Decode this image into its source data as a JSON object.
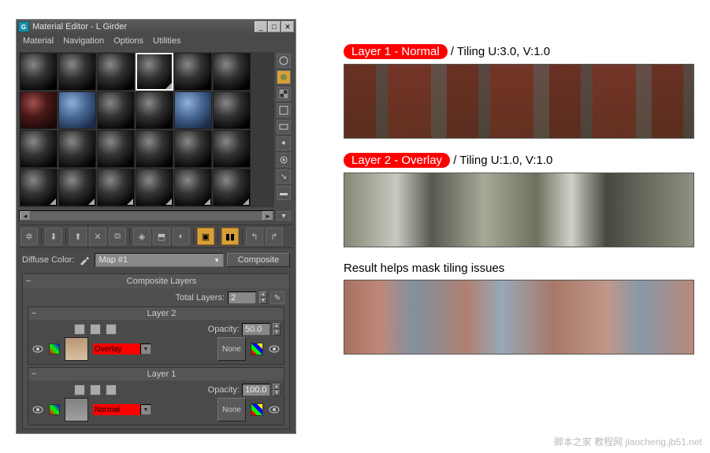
{
  "window": {
    "title": "Material Editor - L Girder",
    "app_icon_letter": "G"
  },
  "menubar": [
    "Material",
    "Navigation",
    "Options",
    "Utilities"
  ],
  "side_tools": {
    "sphere": "sphere-icon",
    "backlight": "backlight-icon",
    "checker": "checker-icon",
    "sample_uv": "sample-uv-icon",
    "video": "video-color-icon",
    "options": "options-icon",
    "select": "select-by-material-icon",
    "preset": "material-preset-icon"
  },
  "param": {
    "diffuse_label": "Diffuse Color:",
    "map_name": "Map #1",
    "map_type": "Composite"
  },
  "composite": {
    "rollout_title": "Composite Layers",
    "total_label": "Total Layers:",
    "total_value": "2",
    "layers": [
      {
        "title": "Layer 2",
        "opacity_label": "Opacity:",
        "opacity_value": "50.0",
        "blend_mode": "Overlay",
        "mask_label": "None"
      },
      {
        "title": "Layer 1",
        "opacity_label": "Opacity:",
        "opacity_value": "100.0",
        "blend_mode": "Normal",
        "mask_label": "None"
      }
    ]
  },
  "annotations": {
    "layer1_pill": "Layer 1 - Normal",
    "layer1_tiling": " / Tiling U:3.0, V:1.0",
    "layer2_pill": "Layer 2 - Overlay",
    "layer2_tiling": " / Tiling U:1.0, V:1.0",
    "result_label": "Result helps mask tiling issues"
  },
  "watermark": "脚本之家 教程网 jiaocheng.jb51.net"
}
